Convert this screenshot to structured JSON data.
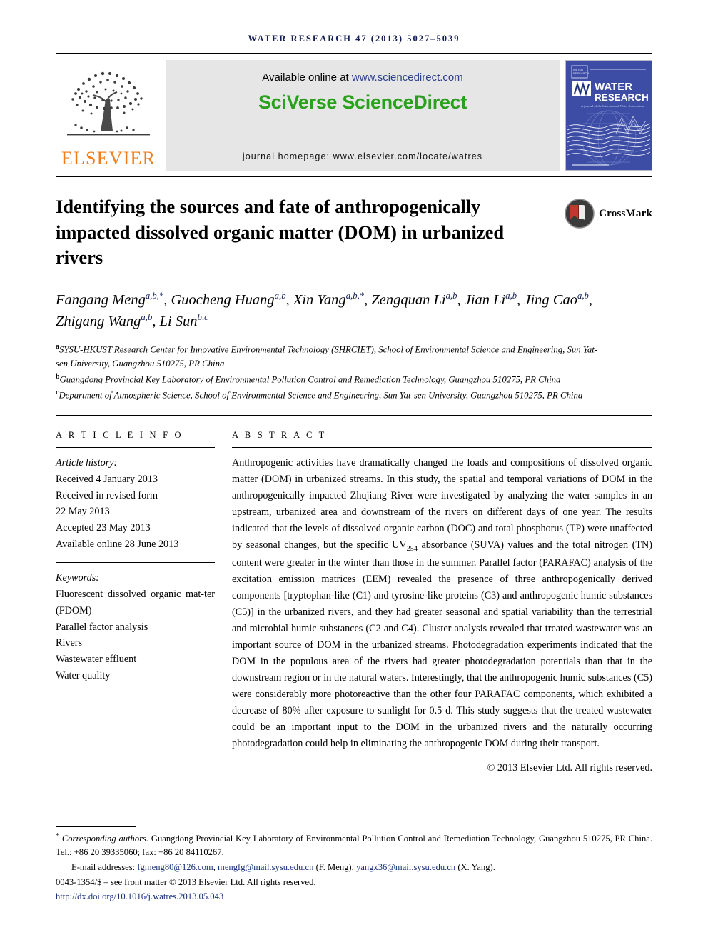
{
  "running_head": "WATER RESEARCH 47 (2013) 5027–5039",
  "masthead": {
    "publisher_name": "ELSEVIER",
    "available_prefix": "Available online at ",
    "available_url": "www.sciencedirect.com",
    "platform_name": "SciVerse ScienceDirect",
    "homepage": "journal homepage: www.elsevier.com/locate/watres",
    "cover": {
      "title_line1": "WATER",
      "title_line2": "RESEARCH",
      "society_logo": "IWA",
      "subtitle": "A journal of the International Water Association"
    }
  },
  "article": {
    "title": "Identifying the sources and fate of anthropogenically impacted dissolved organic matter (DOM) in urbanized rivers",
    "crossmark_label": "CrossMark",
    "authors_html": "Fangang Meng<sup>a,b,*</sup>, Guocheng Huang<sup>a,b</sup>, Xin Yang<sup>a,b,*</sup>, Zengquan Li<sup>a,b</sup>, Jian Li<sup>a,b</sup>, Jing Cao<sup>a,b</sup>, Zhigang Wang<sup>a,b</sup>, Li Sun<sup>b,c</sup>",
    "affiliations": [
      {
        "marker": "a",
        "text": "SYSU-HKUST Research Center for Innovative Environmental Technology (SHRCIET), School of Environmental Science and Engineering, Sun Yat-sen University, Guangzhou 510275, PR China"
      },
      {
        "marker": "b",
        "text": "Guangdong Provincial Key Laboratory of Environmental Pollution Control and Remediation Technology, Guangzhou 510275, PR China"
      },
      {
        "marker": "c",
        "text": "Department of Atmospheric Science, School of Environmental Science and Engineering, Sun Yat-sen University, Guangzhou 510275, PR China"
      }
    ]
  },
  "article_info": {
    "heading": "A R T I C L E   I N F O",
    "history_label": "Article history:",
    "history": [
      "Received 4 January 2013",
      "Received in revised form",
      "22 May 2013",
      "Accepted 23 May 2013",
      "Available online 28 June 2013"
    ],
    "keywords_label": "Keywords:",
    "keywords": [
      "Fluorescent dissolved organic mat-ter (FDOM)",
      "Parallel factor analysis",
      "Rivers",
      "Wastewater effluent",
      "Water quality"
    ]
  },
  "abstract": {
    "heading": "A B S T R A C T",
    "text_part1": "Anthropogenic activities have dramatically changed the loads and compositions of dissolved organic matter (DOM) in urbanized streams. In this study, the spatial and temporal variations of DOM in the anthropogenically impacted Zhujiang River were investigated by analyzing the water samples in an upstream, urbanized area and downstream of the rivers on different days of one year. The results indicated that the levels of dissolved organic carbon (DOC) and total phosphorus (TP) were unaffected by seasonal changes, but the specific UV",
    "subscript": "254",
    "text_part2": " absorbance (SUVA) values and the total nitrogen (TN) content were greater in the winter than those in the summer. Parallel factor (PARAFAC) analysis of the excitation emission matrices (EEM) revealed the presence of three anthropogenically derived components [tryptophan-like (C1) and tyrosine-like proteins (C3) and anthropogenic humic substances (C5)] in the urbanized rivers, and they had greater seasonal and spatial variability than the terrestrial and microbial humic substances (C2 and C4). Cluster analysis revealed that treated wastewater was an important source of DOM in the urbanized streams. Photodegradation experiments indicated that the DOM in the populous area of the rivers had greater photodegradation potentials than that in the downstream region or in the natural waters. Interestingly, that the anthropogenic humic substances (C5) were considerably more photoreactive than the other four PARAFAC components, which exhibited a decrease of 80% after exposure to sunlight for 0.5 d. This study suggests that the treated wastewater could be an important input to the DOM in the urbanized rivers and the naturally occurring photodegradation could help in eliminating the anthropogenic DOM during their transport.",
    "copyright": "© 2013 Elsevier Ltd. All rights reserved."
  },
  "footnotes": {
    "corresponding_lead": "Corresponding authors.",
    "corresponding_rest": " Guangdong Provincial Key Laboratory of Environmental Pollution Control and Remediation Technology, Guangzhou 510275, PR China. Tel.: +86 20 39335060; fax: +86 20 84110267.",
    "email_label": "E-mail addresses:",
    "email1": "fgmeng80@126.com",
    "email2": "mengfg@mail.sysu.edu.cn",
    "email1_owner": "(F. Meng),",
    "email3": "yangx36@mail.sysu.edu.cn",
    "email3_owner": "(X. Yang).",
    "issn_line": "0043-1354/$ – see front matter © 2013 Elsevier Ltd. All rights reserved.",
    "doi": "http://dx.doi.org/10.1016/j.watres.2013.05.043"
  },
  "colors": {
    "navy": "#141e55",
    "link_blue": "#17307a",
    "elsevier_orange": "#f07d1a",
    "sciencedirect_green": "#2aa11c",
    "cover_blue": "#3a4aa0",
    "band_gray": "#e6e6e6"
  }
}
